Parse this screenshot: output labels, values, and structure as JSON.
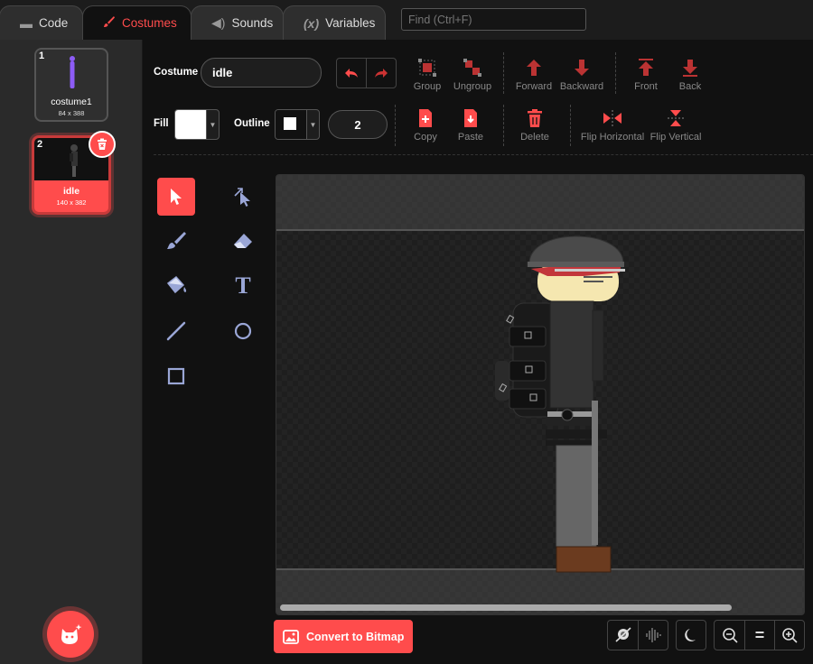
{
  "tabs": [
    {
      "label": "Code",
      "icon": "code-blocks-icon"
    },
    {
      "label": "Costumes",
      "icon": "paintbrush-icon"
    },
    {
      "label": "Sounds",
      "icon": "speaker-icon"
    },
    {
      "label": "Variables",
      "icon": "variable-icon"
    }
  ],
  "tab_variables_glyph": "(x)",
  "search": {
    "placeholder": "Find (Ctrl+F)"
  },
  "costumes": [
    {
      "number": "1",
      "name": "costume1",
      "size": "84 x 388"
    },
    {
      "number": "2",
      "name": "idle",
      "size": "140 x 382"
    }
  ],
  "editor": {
    "costume_label": "Costume",
    "costume_name": "idle",
    "fill_label": "Fill",
    "outline_label": "Outline",
    "outline_width": "2",
    "fill_color": "#ffffff",
    "outline_color": "#ffffff",
    "accent": "#ff4c4c"
  },
  "toolbar": {
    "group": "Group",
    "ungroup": "Ungroup",
    "forward": "Forward",
    "backward": "Backward",
    "front": "Front",
    "back": "Back",
    "copy": "Copy",
    "paste": "Paste",
    "delete": "Delete",
    "flip_h": "Flip Horizontal",
    "flip_v": "Flip Vertical"
  },
  "tools": [
    "select-tool",
    "reshape-tool",
    "brush-tool",
    "eraser-tool",
    "fill-tool",
    "text-tool",
    "line-tool",
    "circle-tool",
    "rectangle-tool"
  ],
  "text_tool_glyph": "T",
  "convert_label": "Convert to Bitmap",
  "zoom_reset_glyph": "="
}
